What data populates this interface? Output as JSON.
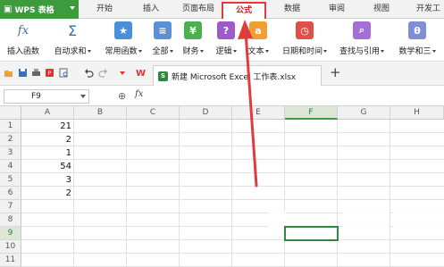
{
  "app_menu": {
    "label": "WPS 表格"
  },
  "tabs": [
    {
      "label": "开始"
    },
    {
      "label": "插入"
    },
    {
      "label": "页面布局"
    },
    {
      "label": "公式",
      "active": true
    },
    {
      "label": "数据"
    },
    {
      "label": "审阅"
    },
    {
      "label": "视图"
    },
    {
      "label": "开发工"
    }
  ],
  "ribbon": {
    "insert_function": "插入函数",
    "autosum": "自动求和",
    "common_functions": "常用函数",
    "all": "全部",
    "finance": "财务",
    "logic": "逻辑",
    "text": "文本",
    "datetime": "日期和时间",
    "lookup": "查找与引用",
    "math": "数学和三"
  },
  "icons": {
    "fx": "fx",
    "sigma": "Σ",
    "star": "★",
    "question": "?",
    "text_a": "a",
    "clock": "◷",
    "search": "⌕",
    "theta": "θ"
  },
  "document": {
    "tab_title": "新建 Microsoft Excel 工作表.xlsx"
  },
  "formula_bar": {
    "name_box": "F9",
    "fx_label": "fx",
    "value": ""
  },
  "columns": [
    "A",
    "B",
    "C",
    "D",
    "E",
    "F",
    "G",
    "H"
  ],
  "rows": [
    "1",
    "2",
    "3",
    "4",
    "5",
    "6",
    "7",
    "8",
    "9",
    "10",
    "11"
  ],
  "cells_a": [
    "21",
    "2",
    "1",
    "54",
    "3",
    "2"
  ],
  "colors": {
    "accent_green": "#3c9b3c",
    "annotation_red": "#e13b3b",
    "selection_green": "#2e8b3e"
  }
}
